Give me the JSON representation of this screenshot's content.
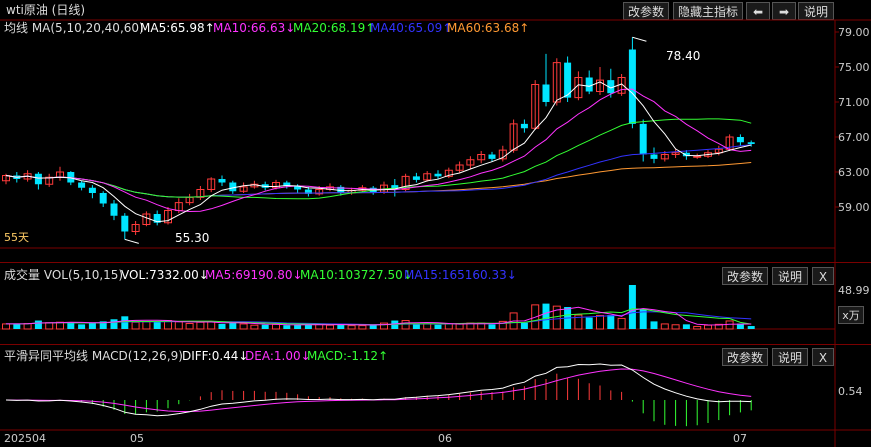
{
  "title": "wti原油 (日线)",
  "toolbar": {
    "change_params": "改参数",
    "hide_indicator": "隐藏主指标",
    "prev_icon": "arrow-left-icon",
    "next_icon": "arrow-right-icon",
    "explain": "说明"
  },
  "main_panel": {
    "ma_label": "均线 MA(5,10,20,40,60)",
    "ma5": "MA5:65.98↑",
    "ma10": "MA10:66.63↓",
    "ma20": "MA20:68.19↑",
    "ma40": "MA40:65.09↑",
    "ma60": "MA60:63.68↑",
    "period_label": "55天",
    "high_label": "78.40",
    "low_label": "55.30",
    "y_ticks": [
      "79.00",
      "75.00",
      "71.00",
      "67.00",
      "63.00",
      "59.00"
    ]
  },
  "vol_panel": {
    "label": "成交量 VOL(5,10,15)",
    "vol": "VOL:7332.00↓",
    "ma5": "MA5:69190.80↓",
    "ma10": "MA10:103727.50↓",
    "ma15": "MA15:165160.33↓",
    "change_params": "改参数",
    "explain": "说明",
    "close": "X",
    "y_tick": "48.99",
    "unit": "x万"
  },
  "macd_panel": {
    "label": "平滑异同平均线 MACD(12,26,9)",
    "diff": "DIFF:0.44↓",
    "dea": "DEA:1.00↓",
    "macd": "MACD:-1.12↑",
    "change_params": "改参数",
    "explain": "说明",
    "close": "X",
    "y_tick": "0.54"
  },
  "x_labels": [
    "202504",
    "05",
    "06",
    "07"
  ],
  "colors": {
    "up": "#ff3b3b",
    "down": "#00e5ff",
    "ma5": "#ffffff",
    "ma10": "#ff33ff",
    "ma20": "#33ff33",
    "ma40": "#3333ff",
    "ma60": "#ff9933",
    "grid": "#7a0000"
  },
  "chart_data": {
    "type": "candlestick",
    "ylim": [
      55,
      79
    ],
    "candles": [
      [
        62.0,
        62.6,
        61.6,
        62.8
      ],
      [
        62.6,
        62.2,
        61.8,
        63.0
      ],
      [
        62.2,
        62.8,
        61.9,
        63.2
      ],
      [
        62.8,
        61.6,
        61.0,
        63.0
      ],
      [
        61.6,
        62.4,
        61.3,
        62.8
      ],
      [
        62.4,
        63.0,
        62.0,
        63.6
      ],
      [
        63.0,
        61.8,
        61.5,
        63.1
      ],
      [
        61.8,
        61.2,
        60.9,
        62.0
      ],
      [
        61.2,
        60.6,
        60.0,
        61.5
      ],
      [
        60.6,
        59.4,
        59.0,
        60.8
      ],
      [
        59.4,
        58.0,
        57.5,
        59.8
      ],
      [
        58.0,
        56.2,
        55.3,
        58.3
      ],
      [
        56.2,
        57.0,
        55.8,
        57.4
      ],
      [
        57.0,
        58.2,
        56.8,
        58.5
      ],
      [
        58.2,
        57.2,
        56.9,
        58.6
      ],
      [
        57.2,
        58.6,
        57.0,
        59.0
      ],
      [
        58.6,
        59.5,
        58.3,
        60.0
      ],
      [
        59.5,
        60.1,
        59.2,
        60.5
      ],
      [
        60.1,
        61.0,
        59.8,
        61.4
      ],
      [
        61.0,
        62.2,
        60.7,
        62.4
      ],
      [
        62.2,
        61.8,
        61.4,
        62.6
      ],
      [
        61.8,
        60.8,
        60.5,
        62.0
      ],
      [
        60.8,
        61.3,
        60.6,
        61.8
      ],
      [
        61.3,
        61.6,
        61.1,
        62.0
      ],
      [
        61.6,
        61.2,
        60.9,
        61.9
      ],
      [
        61.2,
        61.8,
        61.0,
        62.1
      ],
      [
        61.8,
        61.4,
        61.1,
        62.0
      ],
      [
        61.4,
        61.0,
        60.6,
        61.6
      ],
      [
        61.0,
        60.5,
        60.2,
        61.3
      ],
      [
        60.5,
        61.0,
        60.3,
        61.4
      ],
      [
        61.0,
        61.3,
        60.8,
        61.7
      ],
      [
        61.3,
        60.6,
        60.3,
        61.5
      ],
      [
        60.6,
        60.9,
        60.4,
        61.2
      ],
      [
        60.9,
        61.2,
        60.7,
        61.5
      ],
      [
        61.2,
        60.7,
        60.4,
        61.4
      ],
      [
        60.7,
        61.5,
        60.5,
        61.9
      ],
      [
        61.5,
        61.0,
        60.2,
        62.2
      ],
      [
        61.0,
        62.5,
        60.8,
        62.8
      ],
      [
        62.5,
        62.1,
        61.8,
        62.9
      ],
      [
        62.1,
        62.8,
        61.9,
        63.1
      ],
      [
        62.8,
        62.5,
        62.2,
        63.2
      ],
      [
        62.5,
        63.2,
        62.3,
        63.5
      ],
      [
        63.2,
        63.8,
        62.9,
        64.2
      ],
      [
        63.8,
        64.4,
        63.4,
        64.8
      ],
      [
        64.4,
        65.0,
        64.0,
        65.4
      ],
      [
        65.0,
        64.5,
        64.2,
        65.3
      ],
      [
        64.5,
        65.5,
        64.2,
        66.0
      ],
      [
        65.5,
        68.5,
        65.2,
        69.0
      ],
      [
        68.5,
        68.0,
        67.5,
        69.0
      ],
      [
        68.0,
        73.0,
        67.8,
        73.5
      ],
      [
        73.0,
        71.0,
        70.5,
        76.5
      ],
      [
        71.0,
        75.5,
        70.6,
        76.0
      ],
      [
        75.5,
        71.5,
        71.0,
        76.2
      ],
      [
        71.5,
        73.8,
        71.2,
        74.5
      ],
      [
        73.8,
        72.2,
        71.9,
        74.6
      ],
      [
        72.2,
        73.5,
        71.8,
        75.0
      ],
      [
        73.5,
        72.0,
        71.5,
        74.8
      ],
      [
        72.0,
        73.8,
        71.7,
        74.2
      ],
      [
        77.0,
        68.5,
        68.0,
        78.4
      ],
      [
        68.5,
        65.0,
        64.2,
        69.0
      ],
      [
        65.0,
        64.5,
        64.0,
        65.8
      ],
      [
        64.5,
        65.0,
        64.2,
        65.4
      ],
      [
        65.0,
        65.2,
        64.6,
        65.6
      ],
      [
        65.2,
        64.8,
        64.4,
        65.5
      ],
      [
        64.8,
        64.8,
        64.5,
        65.1
      ],
      [
        64.8,
        65.2,
        64.6,
        65.5
      ],
      [
        65.2,
        65.6,
        64.9,
        66.0
      ],
      [
        65.6,
        67.0,
        65.4,
        67.3
      ],
      [
        67.0,
        66.4,
        66.0,
        67.3
      ],
      [
        66.4,
        66.2,
        65.9,
        66.6
      ]
    ]
  }
}
